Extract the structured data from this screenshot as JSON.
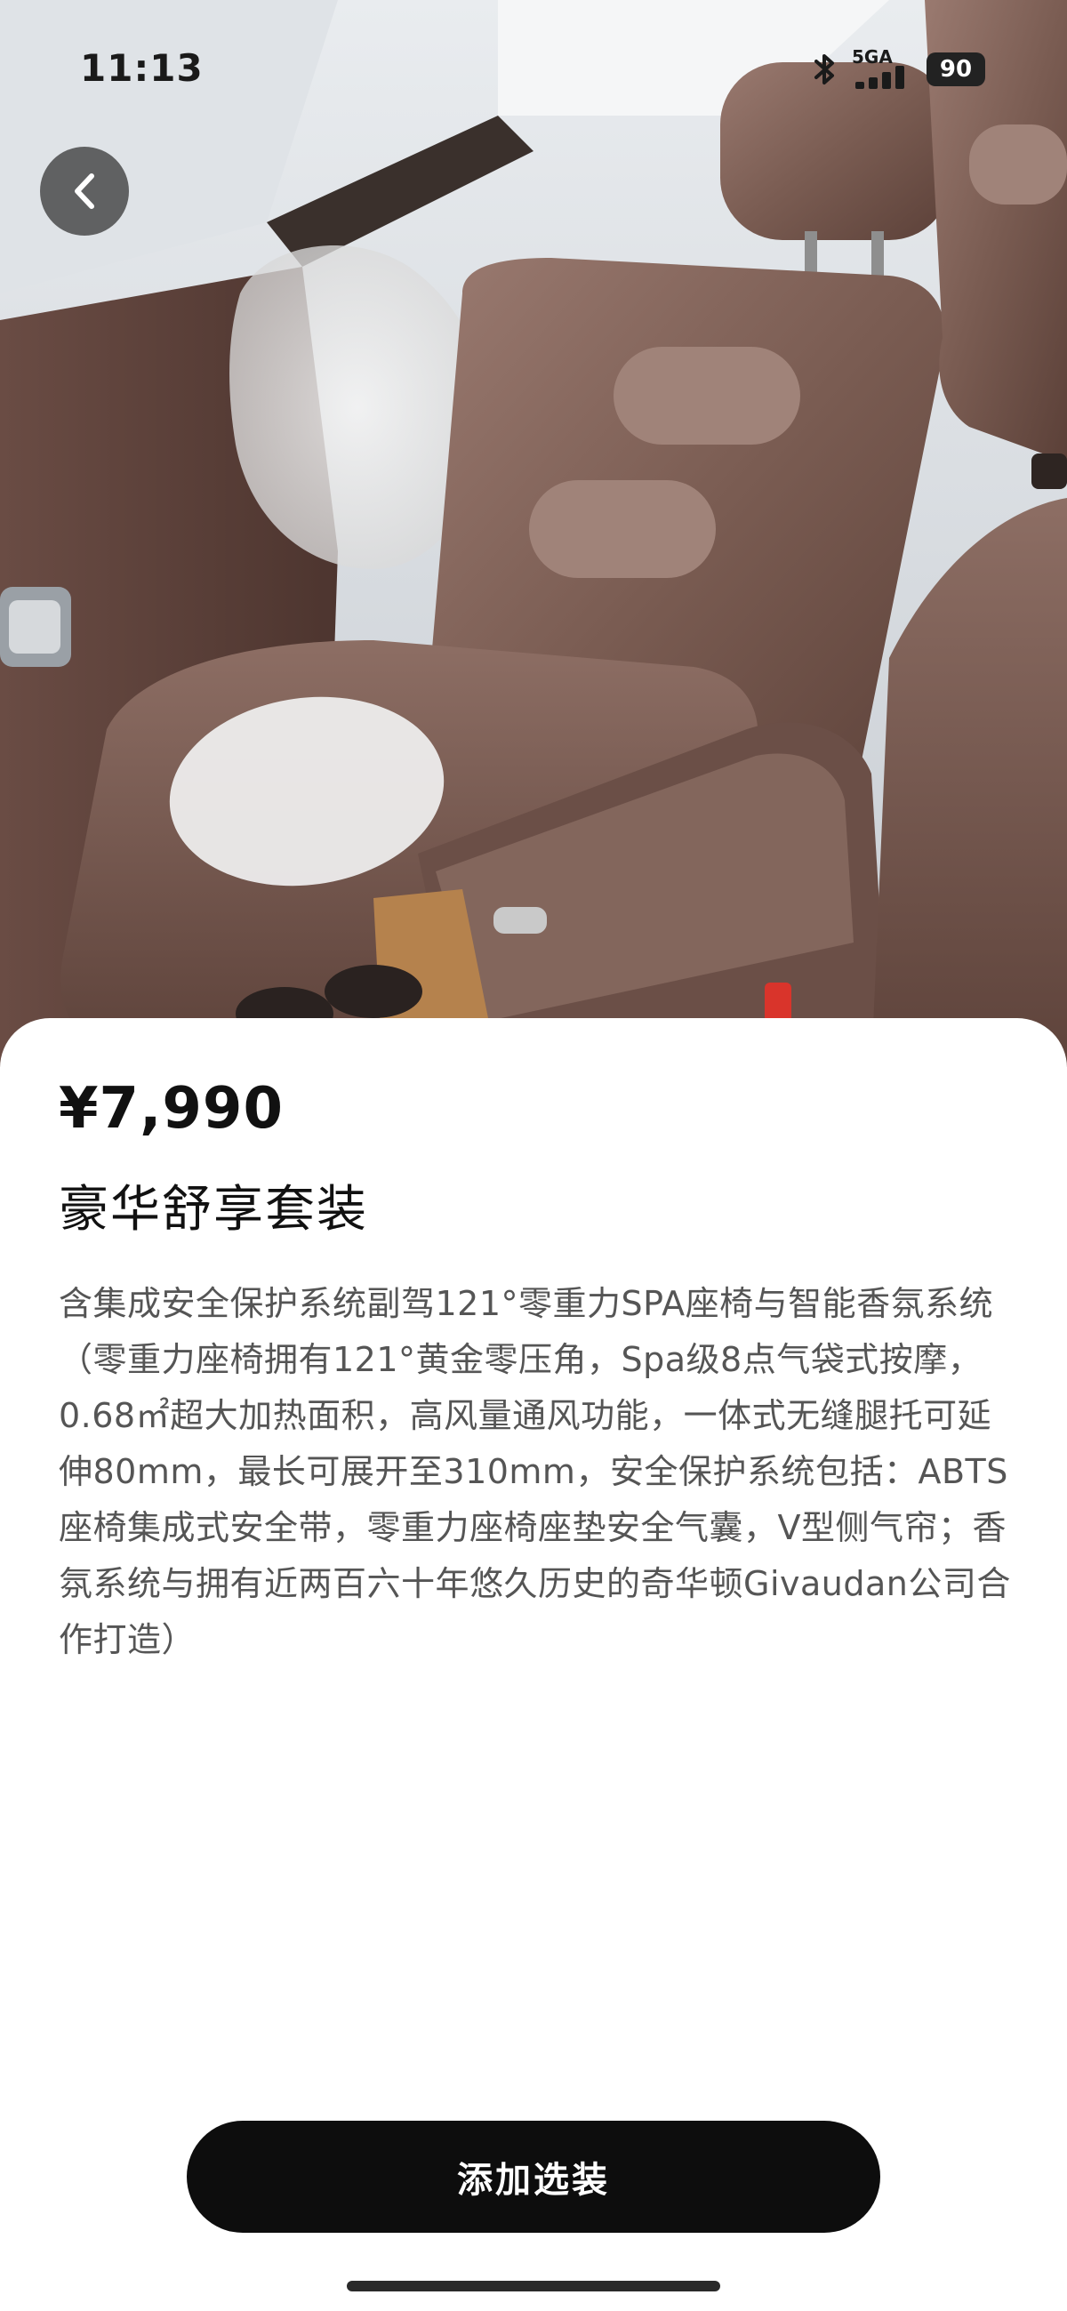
{
  "status_bar": {
    "time": "11:13",
    "network": "5GA",
    "battery": "90"
  },
  "hero": {
    "icon": "car-seat-interior-image"
  },
  "navigation": {
    "back_icon": "chevron-left-icon"
  },
  "product": {
    "price": "¥7,990",
    "title": "豪华舒享套装",
    "description": "含集成安全保护系统副驾121°零重力SPA座椅与智能香氛系统（零重力座椅拥有121°黄金零压角，Spa级8点气袋式按摩，0.68㎡超大加热面积，高风量通风功能，一体式无缝腿托可延伸80mm，最长可展开至310mm，安全保护系统包括：ABTS座椅集成式安全带，零重力座椅座垫安全气囊，V型侧气帘；香氛系统与拥有近两百六十年悠久历史的奇华顿Givaudan公司合作打造）"
  },
  "actions": {
    "add_label": "添加选装"
  },
  "colors": {
    "button_bg": "#0d0d0d",
    "seat_leather": "#7a5c52",
    "text_primary": "#111111",
    "text_secondary": "#555555"
  }
}
